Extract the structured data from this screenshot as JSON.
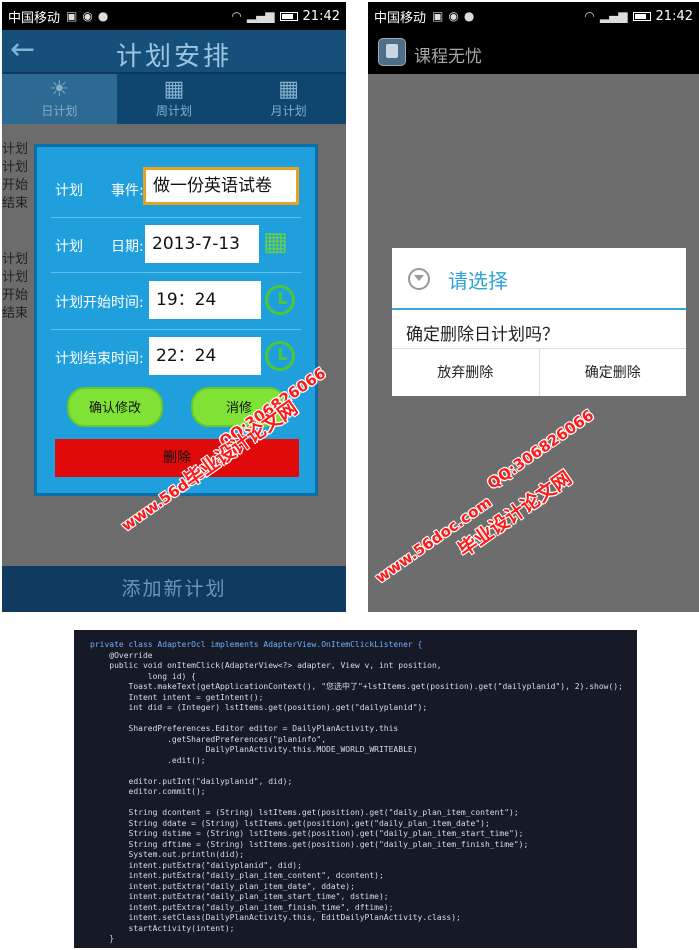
{
  "status_bar": {
    "carrier": "中国移动",
    "time": "21:42"
  },
  "left_screen": {
    "header_title": "计划安排",
    "tabs": [
      {
        "label": "日计划",
        "icon": "sun-icon"
      },
      {
        "label": "周计划",
        "icon": "calendar-icon"
      },
      {
        "label": "月计划",
        "icon": "calendar-icon"
      }
    ],
    "list_fragments": [
      "计划",
      "计划",
      "开始",
      "结束",
      "计划",
      "计划",
      "开始",
      "结束"
    ],
    "dialog": {
      "event_label_prefix": "计划",
      "event_label": "事件:",
      "event_value": "做一份英语试卷",
      "date_label_prefix": "计划",
      "date_label": "日期:",
      "date_value": "2013-7-13",
      "start_label": "计划开始时间:",
      "start_value": "19：24",
      "end_label": "计划结束时间:",
      "end_value": "22：24",
      "confirm_button": "确认修改",
      "cancel_button_partial": "消修",
      "delete_button": "删除"
    },
    "bottom_button": "添加新计划"
  },
  "right_screen": {
    "app_title": "课程无忧",
    "dialog": {
      "title": "请选择",
      "message": "确定删除日计划吗？",
      "negative_button": "放弃删除",
      "positive_button": "确定删除"
    }
  },
  "watermarks": {
    "site": "www.56doc.com",
    "qq": "QQ:306826066",
    "brand": "毕业设计论文网"
  },
  "code_lines": [
    "private class AdapterOcl implements AdapterView.OnItemClickListener {",
    "    @Override",
    "    public void onItemClick(AdapterView<?> adapter, View v, int position,",
    "            long id) {",
    "        Toast.makeText(getApplicationContext(), \"您选中了\"+lstItems.get(position).get(\"dailyplanid\"), 2).show();",
    "        Intent intent = getIntent();",
    "        int did = (Integer) lstItems.get(position).get(\"dailyplanid\");",
    "",
    "        SharedPreferences.Editor editor = DailyPlanActivity.this",
    "                .getSharedPreferences(\"planinfo\",",
    "                        DailyPlanActivity.this.MODE_WORLD_WRITEABLE)",
    "                .edit();",
    "",
    "        editor.putInt(\"dailyplanid\", did);",
    "        editor.commit();",
    "",
    "        String dcontent = (String) lstItems.get(position).get(\"daily_plan_item_content\");",
    "        String ddate = (String) lstItems.get(position).get(\"daily_plan_item_date\");",
    "        String dstime = (String) lstItems.get(position).get(\"daily_plan_item_start_time\");",
    "        String dftime = (String) lstItems.get(position).get(\"daily_plan_item_finish_time\");",
    "        System.out.println(did);",
    "        intent.putExtra(\"dailyplanid\", did);",
    "        intent.putExtra(\"daily_plan_item_content\", dcontent);",
    "        intent.putExtra(\"daily_plan_item_date\", ddate);",
    "        intent.putExtra(\"daily_plan_item_start_time\", dstime);",
    "        intent.putExtra(\"daily_plan_item_finish_time\", dftime);",
    "        intent.setClass(DailyPlanActivity.this, EditDailyPlanActivity.class);",
    "        startActivity(intent);",
    "    }"
  ]
}
